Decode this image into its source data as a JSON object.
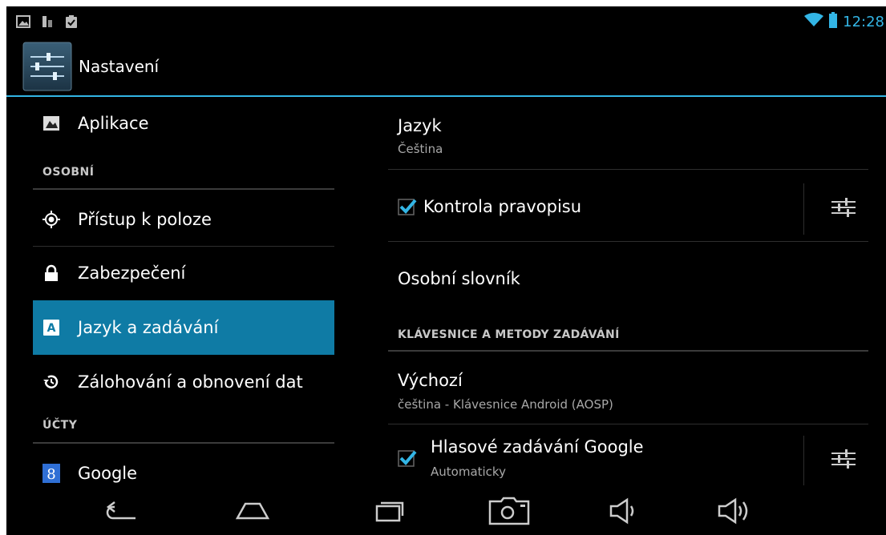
{
  "status_bar": {
    "time": "12:28",
    "left_icons": [
      "gallery-icon",
      "usb-icon",
      "clipboard-check-icon"
    ],
    "right_icons": [
      "wifi-icon",
      "battery-icon"
    ]
  },
  "action_bar": {
    "title": "Nastavení",
    "icon": "settings-sliders-icon"
  },
  "left_pane": {
    "items": [
      {
        "label": "Aplikace",
        "icon": "apps-icon"
      },
      {
        "label": "Přístup k poloze",
        "icon": "location-icon"
      },
      {
        "label": "Zabezpečení",
        "icon": "lock-icon"
      },
      {
        "label": "Jazyk a zadávání",
        "icon": "language-icon",
        "selected": true
      },
      {
        "label": "Zálohování a obnovení dat",
        "icon": "backup-icon"
      },
      {
        "label": "Google",
        "icon": "google-icon"
      }
    ],
    "headers": {
      "personal": "OSOBNÍ",
      "accounts": "ÚČTY"
    }
  },
  "right_pane": {
    "language": {
      "title": "Jazyk",
      "summary": "Čeština"
    },
    "spellcheck": {
      "title": "Kontrola pravopisu",
      "checked": true
    },
    "dictionary": {
      "title": "Osobní slovník"
    },
    "keyboards_header": "KLÁVESNICE A METODY ZADÁVÁNÍ",
    "default": {
      "title": "Výchozí",
      "summary": "čeština - Klávesnice Android (AOSP)"
    },
    "voice": {
      "title": "Hlasové zadávání Google",
      "summary": "Automaticky",
      "checked": true
    }
  },
  "nav_bar": {
    "buttons": [
      "back-icon",
      "home-icon",
      "recents-icon",
      "screenshot-icon",
      "volume-down-icon",
      "volume-up-icon"
    ]
  },
  "colors": {
    "accent": "#33b5e5",
    "selected_bg": "#0f7ba5",
    "background": "#000000"
  }
}
